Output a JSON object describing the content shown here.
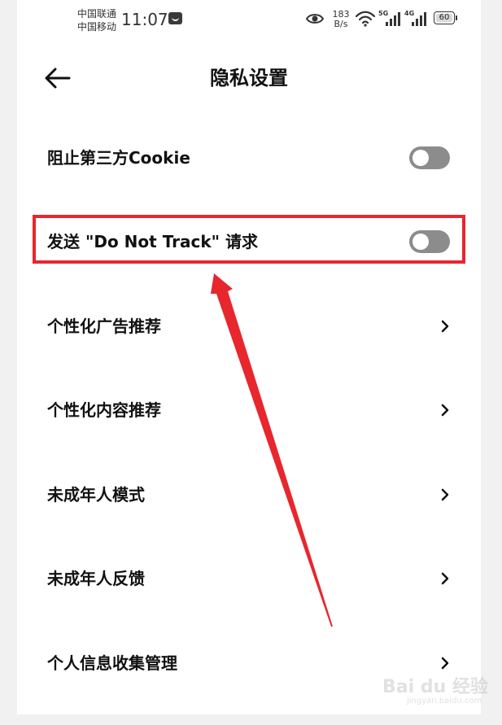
{
  "status_bar": {
    "carrier_1": "中国联通",
    "carrier_2": "中国移动",
    "time": "11:07",
    "net_speed_value": "183",
    "net_speed_unit": "B/s",
    "signal_1_gen": "5G",
    "signal_2_gen": "4G",
    "battery_level": "60",
    "icons": [
      "notification-icon",
      "eye-icon",
      "wifi-icon",
      "signal-icon",
      "battery-icon"
    ]
  },
  "header": {
    "title": "隐私设置",
    "back_icon": "back-arrow-icon"
  },
  "settings": [
    {
      "label": "阻止第三方Cookie",
      "control": "toggle",
      "enabled": false
    },
    {
      "label": "发送 \"Do Not Track\" 请求",
      "control": "toggle",
      "enabled": false
    },
    {
      "label": "个性化广告推荐",
      "control": "chevron"
    },
    {
      "label": "个性化内容推荐",
      "control": "chevron"
    },
    {
      "label": "未成年人模式",
      "control": "chevron"
    },
    {
      "label": "未成年人反馈",
      "control": "chevron"
    },
    {
      "label": "个人信息收集管理",
      "control": "chevron"
    }
  ],
  "annotation": {
    "highlight_color": "#e8262d",
    "highlighted_item": "发送 \"Do Not Track\" 请求"
  },
  "watermark": {
    "main": "Bai du 经验",
    "sub": "jingyan.baidu.com"
  },
  "colors": {
    "toggle_off": "#8c8c8c",
    "background": "#ffffff",
    "text": "#111111",
    "annotation_red": "#e8262d"
  }
}
